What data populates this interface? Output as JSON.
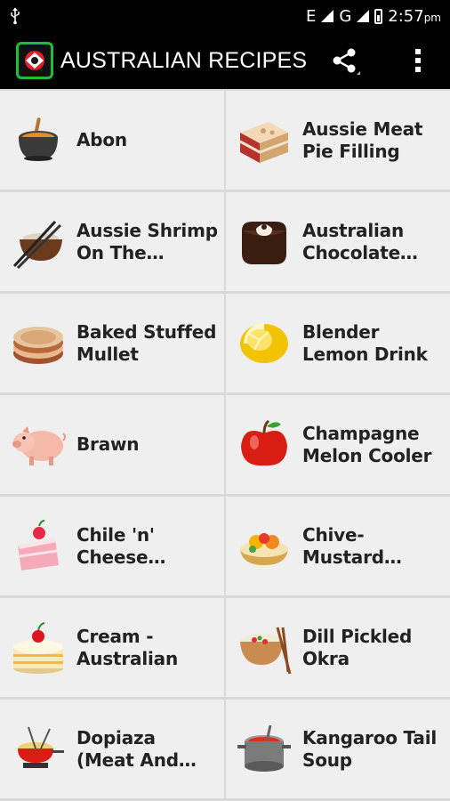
{
  "status": {
    "network": "E",
    "network2": "G",
    "time": "2:57",
    "ampm": "pm"
  },
  "appbar": {
    "title": "AUSTRALIAN RECIPES"
  },
  "recipes": [
    {
      "label": "Abon",
      "icon": "soup-pot-icon"
    },
    {
      "label": "Aussie Meat Pie Filling",
      "icon": "cake-slice-icon"
    },
    {
      "label": "Aussie Shrimp On The Barbie…",
      "icon": "rice-bowl-icon"
    },
    {
      "label": "Australian Chocolate…",
      "icon": "chocolate-icon"
    },
    {
      "label": "Baked Stuffed Mullet",
      "icon": "pancakes-icon"
    },
    {
      "label": "Blender Lemon Drink",
      "icon": "lemon-icon"
    },
    {
      "label": "Brawn",
      "icon": "pig-icon"
    },
    {
      "label": "Champagne Melon Cooler",
      "icon": "apple-icon"
    },
    {
      "label": "Chile 'n' Cheese Breakfast…",
      "icon": "strawberry-cake-icon"
    },
    {
      "label": "Chive-Mustard Potato Salad…",
      "icon": "fruit-tart-icon"
    },
    {
      "label": "Cream - Australian",
      "icon": "cream-cake-icon"
    },
    {
      "label": "Dill Pickled Okra",
      "icon": "noodle-bowl-icon"
    },
    {
      "label": "Dopiaza (Meat And Onion…",
      "icon": "fondue-pot-icon"
    },
    {
      "label": "Kangaroo Tail Soup",
      "icon": "stock-pot-icon"
    }
  ]
}
